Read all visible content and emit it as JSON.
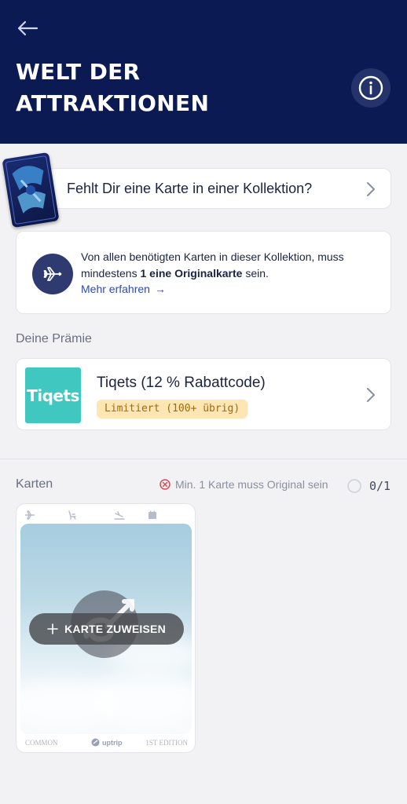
{
  "header": {
    "title_line1": "WELT DER",
    "title_line2": "ATTRAKTIONEN",
    "back_icon": "arrow-left-icon",
    "info_icon": "info-icon",
    "background_color": "#0b1a52"
  },
  "missing_card": {
    "label": "Fehlt Dir eine Karte in einer Kollektion?"
  },
  "info": {
    "text_part1": "Von allen benötigten Karten in dieser Kollektion, muss mindestens ",
    "text_bold": "1 eine Originalkarte",
    "text_part2": " sein.",
    "link_label": "Mehr erfahren",
    "link_arrow": "→"
  },
  "reward": {
    "section_label": "Deine Prämie",
    "logo_text": "Tiqets",
    "title": "Tiqets (12 % Rabattcode)",
    "badge": "Limitiert (100+ übrig)",
    "logo_color": "#3fc7c0",
    "badge_color": "#fde6b3"
  },
  "cards": {
    "section_label": "Karten",
    "requirement": "Min. 1 Karte muss Original sein",
    "count": "0/1",
    "slot": {
      "assign_label": "KARTE ZUWEISEN",
      "footer_left": "COMMON",
      "footer_brand": "uptrip",
      "footer_right": "1ST EDITION",
      "icons": [
        "plane-icon",
        "seat-icon",
        "landing-icon",
        "calendar-icon"
      ]
    }
  }
}
